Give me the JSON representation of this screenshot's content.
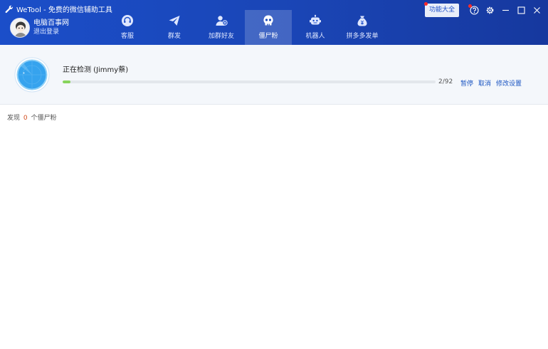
{
  "app": {
    "title": "WeTool - 免费的微信辅助工具"
  },
  "user": {
    "name": "电脑百事网",
    "logout": "退出登录"
  },
  "nav": [
    {
      "label": "客服",
      "icon": "headset-icon",
      "active": false
    },
    {
      "label": "群发",
      "icon": "paper-plane-icon",
      "active": false
    },
    {
      "label": "加群好友",
      "icon": "add-user-icon",
      "active": false
    },
    {
      "label": "僵尸粉",
      "icon": "skull-icon",
      "active": true
    },
    {
      "label": "机器人",
      "icon": "robot-icon",
      "active": false
    },
    {
      "label": "拼多多发单",
      "icon": "money-bag-icon",
      "active": false
    }
  ],
  "toolbar": {
    "features_label": "功能大全"
  },
  "progress": {
    "title": "正在检测 (Jimmy蔡)",
    "current": 2,
    "total": 92,
    "count_text": "2/92",
    "pause_label": "暂停",
    "cancel_label": "取消",
    "settings_label": "修改设置"
  },
  "summary": {
    "prefix": "发现",
    "count": "0",
    "suffix": "个僵尸粉"
  },
  "colors": {
    "header": "#1b4ec9",
    "progress": "#87d45c",
    "link": "#1b55c2",
    "count": "#d14c1d"
  }
}
